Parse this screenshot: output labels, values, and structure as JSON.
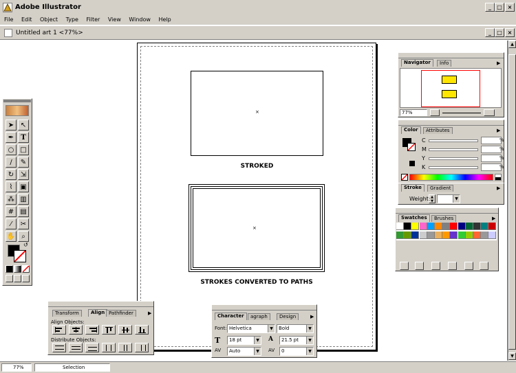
{
  "app": {
    "title": "Adobe Illustrator"
  },
  "menu": [
    "File",
    "Edit",
    "Object",
    "Type",
    "Filter",
    "View",
    "Window",
    "Help"
  ],
  "document": {
    "title": "Untitled art 1 <77%>"
  },
  "artwork": {
    "label_stroked": "STROKED",
    "label_converted": "STROKES CONVERTED TO PATHS"
  },
  "status": {
    "zoom": "77%",
    "tool": "Selection"
  },
  "navigator": {
    "tabs": [
      "Navigator",
      "Info"
    ],
    "zoom": "77%"
  },
  "color": {
    "tabs": [
      "Color",
      "Attributes"
    ],
    "channels": [
      "C",
      "M",
      "Y",
      "K"
    ],
    "values": [
      "%",
      "%",
      "%",
      "%"
    ],
    "pct": "%"
  },
  "stroke": {
    "tabs": [
      "Stroke",
      "Gradient"
    ],
    "weight_label": "Weight:"
  },
  "swatches": {
    "tabs": [
      "Swatches",
      "Brushes"
    ],
    "colors": [
      "#ffffff",
      "#000000",
      "#ffff00",
      "#ff66cc",
      "#00a0ff",
      "#ff8800",
      "#808080",
      "#ff0000",
      "#000080",
      "#006633",
      "#333333",
      "#008080",
      "#cc0000",
      "#339933",
      "#669900",
      "#003399",
      "#cccccc",
      "#999999",
      "#e8b060",
      "#ff9900",
      "#6633cc",
      "#33cc33",
      "#99cc00",
      "#ff6633",
      "#999999",
      "#ccccff"
    ]
  },
  "align": {
    "tabs": [
      "Transform",
      "Align",
      "Pathfinder"
    ],
    "align_label": "Align Objects:",
    "distribute_label": "Distribute Objects:"
  },
  "character": {
    "tabs": [
      "Character",
      "Paragraph",
      "MM Design"
    ],
    "tab_labels": [
      "Character",
      "agraph",
      "Design"
    ],
    "font_label": "Font:",
    "font": "Helvetica",
    "style": "Bold",
    "size": "18 pt",
    "leading": "21.5 pt",
    "kerning": "Auto",
    "tracking": "0"
  },
  "colors": {
    "titlebar": "#d4d0c8",
    "panel": "#d4d0c8",
    "highlight": "#ff0000"
  }
}
